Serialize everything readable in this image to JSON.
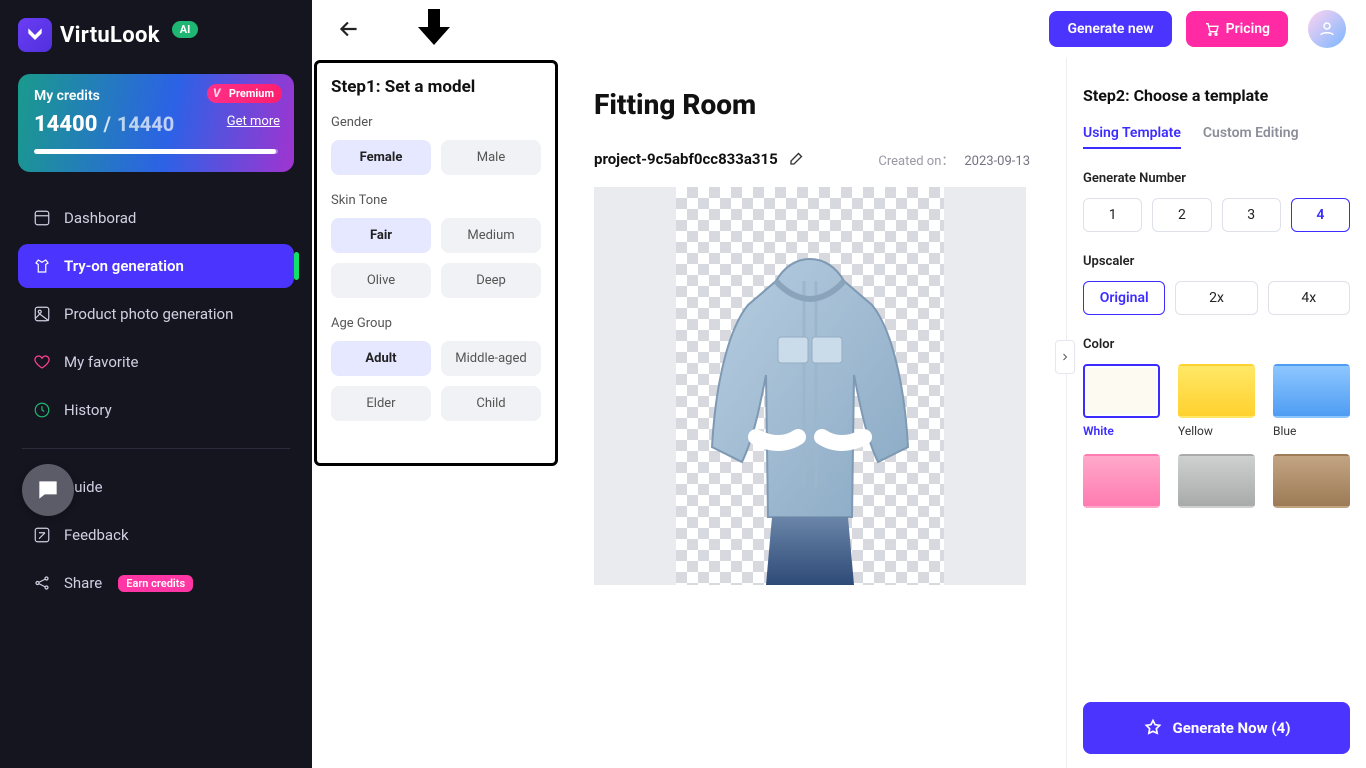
{
  "brand": {
    "name": "VirtuLook",
    "ai_badge": "AI"
  },
  "credits": {
    "title": "My credits",
    "premium": "Premium",
    "current": "14400",
    "total": "14440",
    "get_more": "Get more"
  },
  "nav": {
    "dashboard": "Dashborad",
    "tryon": "Try-on generation",
    "product": "Product photo generation",
    "favorite": "My favorite",
    "history": "History",
    "guide": "Guide",
    "feedback": "Feedback",
    "share": "Share",
    "share_badge": "Earn credits"
  },
  "topbar": {
    "generate_new": "Generate new",
    "pricing": "Pricing"
  },
  "step1": {
    "title": "Step1: Set a model",
    "gender": {
      "label": "Gender",
      "options": [
        "Female",
        "Male"
      ],
      "selected": 0
    },
    "skintone": {
      "label": "Skin Tone",
      "options": [
        "Fair",
        "Medium",
        "Olive",
        "Deep"
      ],
      "selected": 0
    },
    "agegroup": {
      "label": "Age Group",
      "options": [
        "Adult",
        "Middle-aged",
        "Elder",
        "Child"
      ],
      "selected": 0
    }
  },
  "center": {
    "title": "Fitting Room",
    "project_name": "project-9c5abf0cc833a315",
    "created_label": "Created on：",
    "created_date": "2023-09-13"
  },
  "step2": {
    "title": "Step2: Choose a template",
    "tabs": [
      "Using Template",
      "Custom Editing"
    ],
    "tab_active": 0,
    "generate_number": {
      "label": "Generate Number",
      "options": [
        "1",
        "2",
        "3",
        "4"
      ],
      "selected": 3
    },
    "upscaler": {
      "label": "Upscaler",
      "options": [
        "Original",
        "2x",
        "4x"
      ],
      "selected": 0
    },
    "color": {
      "label": "Color",
      "items": [
        {
          "name": "White",
          "hex": "#fdfbf1",
          "selected": true
        },
        {
          "name": "Yellow",
          "hex": "#ffe24d"
        },
        {
          "name": "Blue",
          "hex": "#6fb2f7"
        },
        {
          "name": "",
          "hex": "#ff8fba"
        },
        {
          "name": "",
          "hex": "#bcbdbd"
        },
        {
          "name": "",
          "hex": "#b2926f"
        }
      ]
    },
    "generate_now": "Generate Now (4)"
  }
}
